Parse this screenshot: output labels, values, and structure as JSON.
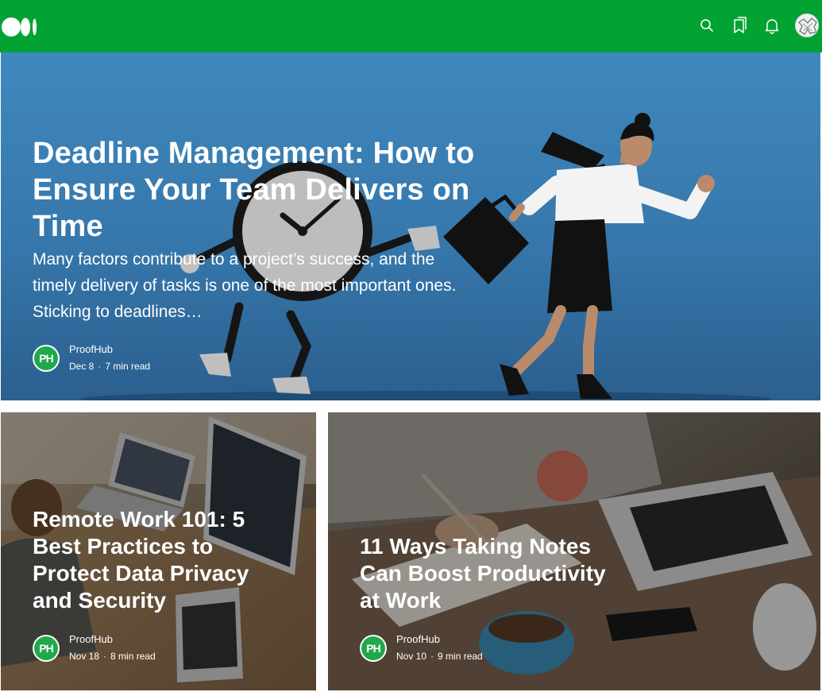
{
  "header": {
    "logo": "medium-logo",
    "icons": [
      "search-icon",
      "bookmarks-icon",
      "notifications-icon"
    ],
    "avatar": "user-avatar"
  },
  "hero": {
    "title": "Deadline Management: How to Ensure Your Team Delivers on Time",
    "subtitle": "Many factors contribute to a project’s success, and the timely delivery of tasks is one of the most important ones. Sticking to deadlines…",
    "author": "ProofHub",
    "author_badge": "PH",
    "date": "Dec 8",
    "read_time": "7 min read"
  },
  "cards": [
    {
      "title": "Remote Work 101: 5 Best Practices to Protect Data Privacy and Security",
      "author": "ProofHub",
      "author_badge": "PH",
      "date": "Nov 18",
      "read_time": "8 min read"
    },
    {
      "title": "11 Ways Taking Notes Can Boost Productivity at Work",
      "author": "ProofHub",
      "author_badge": "PH",
      "date": "Nov 10",
      "read_time": "9 min read"
    }
  ],
  "colors": {
    "header_bg": "#02a333",
    "badge": "#21a84a",
    "hero_bg": "#3a7fb5"
  }
}
